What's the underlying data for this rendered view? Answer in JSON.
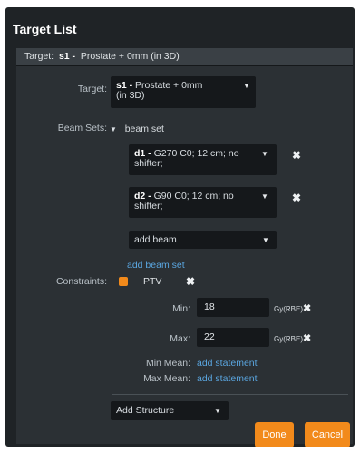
{
  "panel": {
    "title": "Target List"
  },
  "target_header": {
    "prefix": "Target:",
    "id": "s1 -",
    "name": "Prostate + 0mm (in 3D)"
  },
  "target_select": {
    "label": "Target:",
    "id": "s1 -",
    "text_line1": "Prostate + 0mm",
    "text_line2": "(in 3D)"
  },
  "beam_sets": {
    "label": "Beam Sets:",
    "set_label": "beam set",
    "beams": [
      {
        "id": "d1 -",
        "line1": "G270 C0; 12 cm; no",
        "line2": "shifter;"
      },
      {
        "id": "d2 -",
        "line1": "G90 C0; 12 cm; no",
        "line2": "shifter;"
      }
    ],
    "add_beam": "add beam",
    "add_beam_set": "add beam set"
  },
  "constraints": {
    "label": "Constraints:",
    "structure": "PTV",
    "structure_color": "#f28a1b",
    "min": {
      "label": "Min:",
      "value": "18",
      "unit": "Gy(RBE)"
    },
    "max": {
      "label": "Max:",
      "value": "22",
      "unit": "Gy(RBE)"
    },
    "min_mean": {
      "label": "Min Mean:",
      "link": "add statement"
    },
    "max_mean": {
      "label": "Max Mean:",
      "link": "add statement"
    }
  },
  "add_structure": "Add Structure",
  "buttons": {
    "done": "Done",
    "cancel": "Cancel"
  },
  "colors": {
    "accent": "#f28a1b",
    "link": "#5aa6e0",
    "panel_bg": "#1f2326",
    "inner_bg": "#2b3034"
  }
}
